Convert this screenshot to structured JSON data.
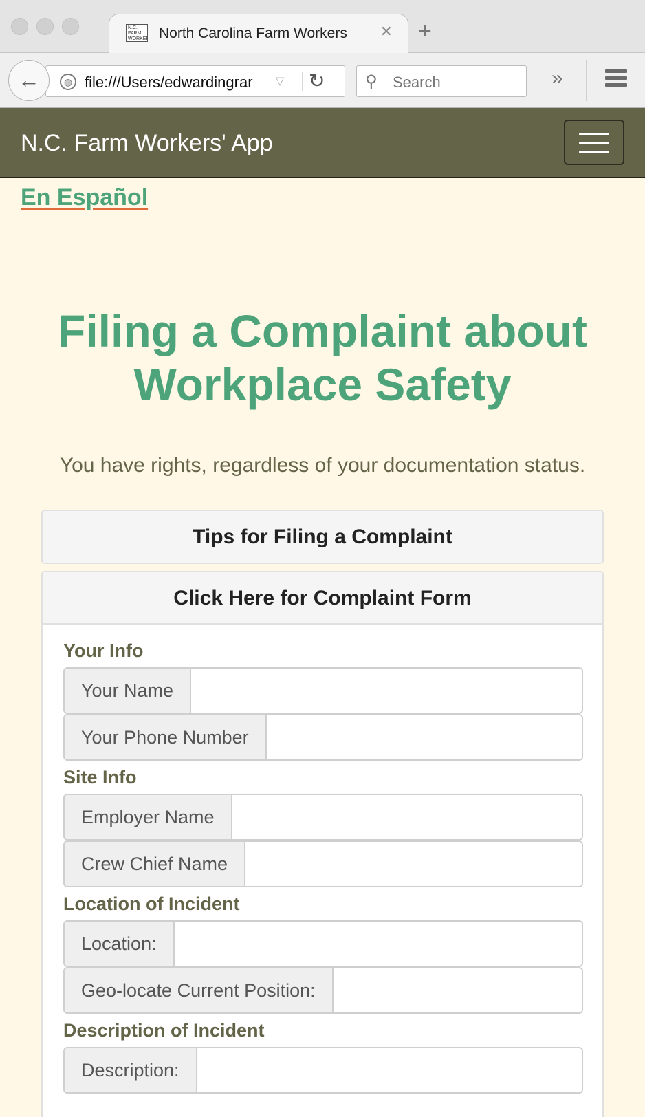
{
  "browser": {
    "tab_title": "North Carolina Farm Workers",
    "favicon_text": "N.C. FARM WORKERS",
    "url": "file:///Users/edwardingrar",
    "search_placeholder": "Search"
  },
  "app": {
    "brand": "N.C. Farm Workers' App",
    "language_link": "En Español"
  },
  "page": {
    "title": "Filing a Complaint about Workplace Safety",
    "subtitle": "You have rights, regardless of your documentation status."
  },
  "panels": {
    "tips": "Tips for Filing a Complaint",
    "form": "Click Here for Complaint Form"
  },
  "form": {
    "sections": [
      {
        "label": "Your Info",
        "fields": [
          "Your Name",
          "Your Phone Number"
        ]
      },
      {
        "label": "Site Info",
        "fields": [
          "Employer Name",
          "Crew Chief Name"
        ]
      },
      {
        "label": "Location of Incident",
        "fields": [
          "Location:",
          "Geo-locate Current Position:"
        ]
      },
      {
        "label": "Description of Incident",
        "fields": [
          "Description:"
        ]
      }
    ]
  },
  "colors": {
    "navbar": "#646449",
    "accent_green": "#4ea47a",
    "background": "#fff8e6"
  }
}
